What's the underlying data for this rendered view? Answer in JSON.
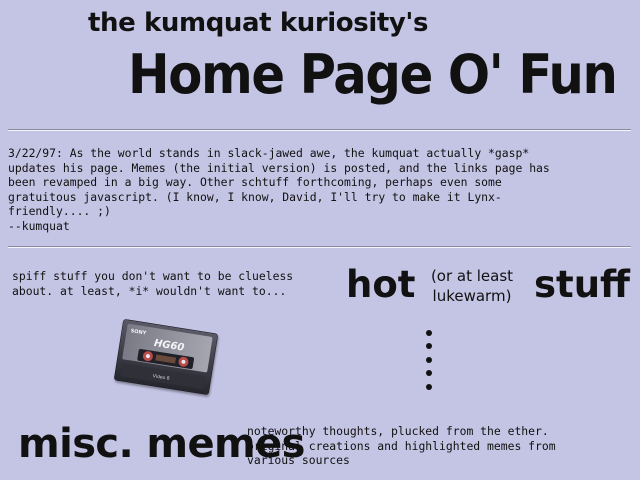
{
  "header": {
    "subtitle": "the kumquat kuriosity's",
    "title": "Home Page O' Fun"
  },
  "news": {
    "text": "3/22/97: As the world stands in slack-jawed awe, the kumquat actually *gasp*\nupdates his page. Memes (the initial version) is posted, and the links page has\nbeen revamped in a big way. Other schtuff forthcoming, perhaps even some\ngratuitous javascript. (I know, I know, David, I'll try to make it Lynx-\nfriendly.... ;)\n--kumquat"
  },
  "hot_stuff": {
    "description": "spiff stuff you don't want to be clueless\nabout. at least, *i* wouldn't want to...",
    "hot": "hot",
    "lukewarm": "(or at least\nlukewarm)",
    "stuff": "stuff",
    "dots_icon": "vertical-ellipsis"
  },
  "memes": {
    "image_label": "cassette-tape",
    "cassette_brand": "SONY",
    "cassette_label": "HG60",
    "cassette_sub": "Video 8",
    "title": "misc. memes",
    "description": "noteworthy thoughts, plucked from the ether.\noriginal creations and highlighted memes from\nvarious sources"
  },
  "colors": {
    "background": "#c4c4e4",
    "text": "#111111",
    "cassette_body": "#3a3a46"
  }
}
